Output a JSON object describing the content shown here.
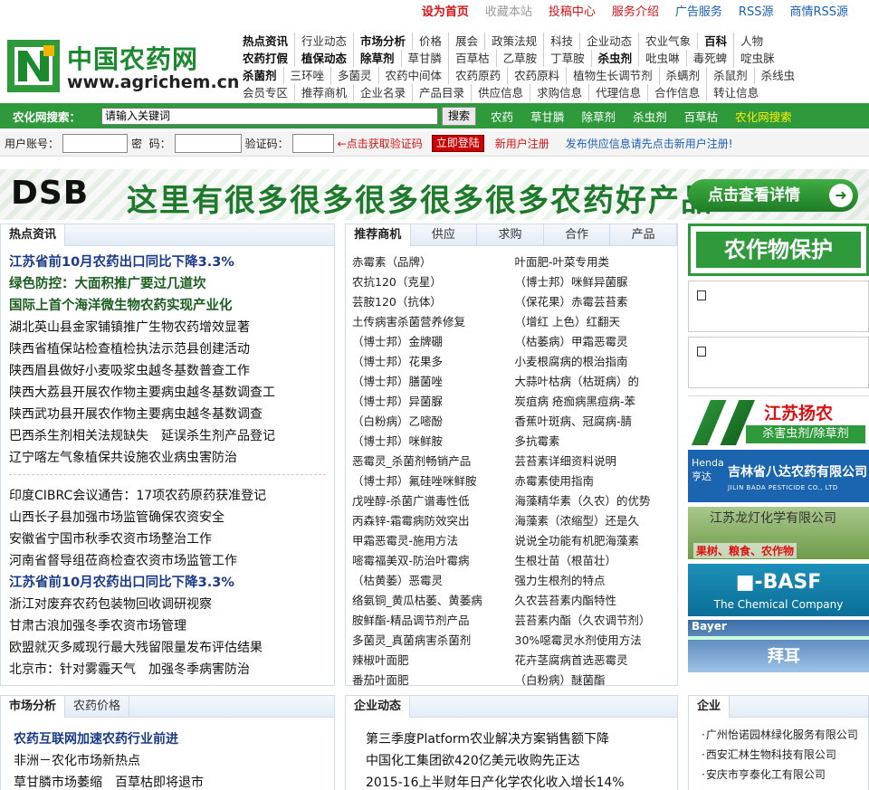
{
  "toplinks": [
    {
      "label": "设为首页",
      "style": "home"
    },
    {
      "label": "收藏本站",
      "style": "grey"
    },
    {
      "label": "投稿中心",
      "style": "red"
    },
    {
      "label": "服务介绍",
      "style": "red"
    },
    {
      "label": "广告服务",
      "style": "blue"
    },
    {
      "label": "RSS源",
      "style": "blue"
    },
    {
      "label": "商情RSS源",
      "style": "blue"
    }
  ],
  "logo": {
    "name": "中国农药网",
    "url": "www.agrichem.cn",
    "mark": "N"
  },
  "nav": {
    "row1": [
      "热点资讯",
      "行业动态",
      "市场分析",
      "价格",
      "展会",
      "政策法规",
      "科技",
      "企业动态",
      "农业气象",
      "百科",
      "人物"
    ],
    "row2": [
      "农药打假",
      "植保动态",
      "除草剂",
      "草甘膦",
      "百草枯",
      "乙草胺",
      "丁草胺",
      "杀虫剂",
      "吡虫啉",
      "毒死蜱",
      "啶虫脒"
    ],
    "row3": [
      "杀菌剂",
      "三环唑",
      "多菌灵",
      "农药中间体",
      "农药原药",
      "农药原料",
      "植物生长调节剂",
      "杀螨剂",
      "杀鼠剂",
      "杀线虫"
    ],
    "row4": [
      "会员专区",
      "推荐商机",
      "企业名录",
      "产品目录",
      "供应信息",
      "求购信息",
      "代理信息",
      "合作信息",
      "转让信息"
    ]
  },
  "search": {
    "label": "农化网搜索：",
    "value": "请输入关键词",
    "button": "搜索",
    "quick": [
      "农药",
      "草甘膦",
      "除草剂",
      "杀虫剂",
      "百草枯",
      "农化网搜索"
    ]
  },
  "login": {
    "user_label": "用户账号：",
    "pw_label": "密  码：",
    "captcha_label": "验证码：",
    "captcha_hint": "←点击获取验证码",
    "login_button": "立即登陆",
    "register": "新用户注册",
    "supply_hint": "发布供应信息请先点击新用户注册!"
  },
  "banner": {
    "brand": "DSB",
    "slogan": "这里有很多很多很多很多很多农药好产品",
    "cta": "点击查看详情",
    "arrow": "➜"
  },
  "hot": {
    "tab": "热点资讯",
    "top": [
      {
        "text": "江苏省前10月农药出口同比下降3.3%",
        "style": "big"
      },
      {
        "text": "绿色防控：大面积推广要过几道坎",
        "style": "big g"
      },
      {
        "text": "国际上首个海洋微生物农药实现产业化",
        "style": "big g"
      }
    ],
    "list1": [
      "湖北英山县金家铺镇推广生物农药增效显著",
      "陕西省植保站检查植检执法示范县创建活动",
      "陕西眉县做好小麦吸浆虫越冬基数普查工作",
      "陕西大荔县开展农作物主要病虫越冬基数调查工",
      "陕西武功县开展农作物主要病虫越冬基数调查",
      "巴西杀生剂相关法规缺失　延误杀生剂产品登记",
      "辽宁喀左气象植保共设施农业病虫害防治"
    ],
    "list2": [
      {
        "text": "印度CIBRC会议通告：17项农药原药获准登记",
        "style": ""
      },
      {
        "text": "山西长子县加强市场监管确保农资安全",
        "style": ""
      },
      {
        "text": "安徽省宁国市秋季农资市场整治工作",
        "style": ""
      },
      {
        "text": "河南省督导组莅商检查农资市场监管工作",
        "style": ""
      },
      {
        "text": "江苏省前10月农药出口同比下降3.3%",
        "style": "big"
      },
      {
        "text": "浙江对废弃农药包装物回收调研视察",
        "style": ""
      },
      {
        "text": "甘肃古浪加强冬季农资市场管理",
        "style": ""
      },
      {
        "text": "欧盟就灭多威现行最大残留限量发布评估结果",
        "style": ""
      },
      {
        "text": "北京市：针对雾霾天气　加强冬季病害防治",
        "style": ""
      }
    ]
  },
  "rec": {
    "tabs": [
      "推荐商机",
      "供应",
      "求购",
      "合作",
      "产品"
    ],
    "left": [
      "赤霉素（品牌）",
      "农抗120（克星）",
      "芸胺120（抗体）",
      "土传病害杀菌营养修复",
      "（博士邦）金牌硼",
      "（博士邦）花果多",
      "（博士邦）膳菌唑",
      "（博士邦）异菌脲",
      "（白粉病）乙嘧酚",
      "（博士邦）咪鲜胺",
      "恶霉灵_杀菌剂畅销产品",
      "（博士邦）氟硅唑咪鲜胺",
      "戊唑醇-杀菌广谱毒性低",
      "丙森锌-霜霉病防效突出",
      "甲霜恶霉灵-施用方法",
      "嘧霉福美双-防治叶霉病",
      "（枯黄萎）恶霉灵",
      "络氨铜_黄瓜枯萎、黄萎病",
      "胺鲜酯-精品调节剂产品",
      "多菌灵_真菌病害杀菌剂",
      "辣椒叶面肥",
      "番茄叶面肥"
    ],
    "right": [
      "叶面肥-叶菜专用类",
      "（博士邦）咪鲜异菌脲",
      "（保花果）赤霉芸苔素",
      "（增红 上色）红翻天",
      "（枯萎病）甲霜恶霉灵",
      "小麦根腐病的根治指南",
      "大蒜叶枯病（枯斑病）的",
      "炭疽病 疮痂病黑痘病-苯",
      "香蕉叶斑病、冠腐病-腈",
      "多抗霉素",
      "芸苔素详细资料说明",
      "赤霉素使用指南",
      "海藻精华素（久农）的优势",
      "海藻素（浓缩型）还是久",
      "说说全功能有机肥海藻素",
      "生根壮苗（根苗壮）",
      "强力生根剂的特点",
      "久农芸苔素内酯特性",
      "芸苔素内酯（久农调节剂）",
      "30%噁霉灵水剂使用方法",
      "花卉茎腐病首选恶霉灵",
      "（白粉病）醚菌酯"
    ]
  },
  "side": {
    "crop": "农作物保护",
    "ad1": {
      "t1": "江苏扬农",
      "t2": "杀害虫剂/除草剂"
    },
    "ad2": {
      "logo": "Henda 亨达",
      "name": "吉林省八达农药有限公司",
      "en": "JILIN BADA PESTICIDE CO., LTD"
    },
    "ad3": {
      "name": "江苏龙灯化学有限公司",
      "crops": "果树、粮食、农作物"
    },
    "ad4": {
      "name": "■-BASF",
      "sub": "The Chemical Company"
    },
    "ad5": {
      "en": "Bayer",
      "name": "拜耳"
    }
  },
  "market": {
    "tabs": [
      "市场分析",
      "农药价格"
    ],
    "items": [
      {
        "text": "农药互联网加速农药行业前进",
        "style": "big"
      },
      {
        "text": "非洲－农化市场新热点",
        "style": ""
      },
      {
        "text": "草甘膦市场萎缩　百草枯即将退市",
        "style": ""
      }
    ]
  },
  "corp": {
    "tab": "企业动态",
    "items": [
      "第三季度Platform农业解决方案销售额下降",
      "中国化工集团欲420亿美元收购先正达",
      "2015-16上半财年日产化学农化收入增长14%"
    ]
  },
  "firm": {
    "tab": "企业",
    "items": [
      "广州怡诺园林绿化服务有限公司",
      "西安汇林生物科技有限公司",
      "安庆市亨泰化工有限公司"
    ]
  }
}
